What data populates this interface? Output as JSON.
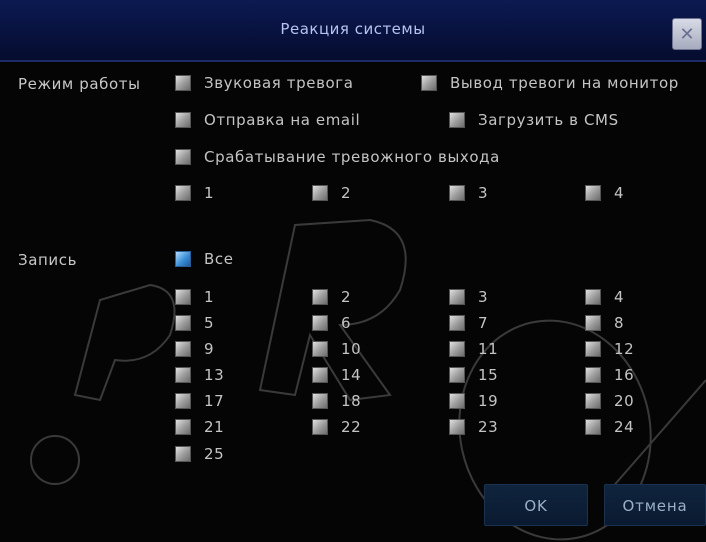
{
  "window": {
    "title": "Реакция системы",
    "close_icon": "close-icon"
  },
  "work_mode": {
    "label": "Режим работы",
    "options": [
      {
        "label": "Звуковая тревога",
        "checked": false
      },
      {
        "label": "Вывод тревоги на монитор",
        "checked": false
      },
      {
        "label": "Отправка на email",
        "checked": false
      },
      {
        "label": "Загрузить в CMS",
        "checked": false
      },
      {
        "label": "Срабатывание тревожного выхода",
        "checked": false
      }
    ],
    "outputs": [
      {
        "label": "1",
        "checked": false
      },
      {
        "label": "2",
        "checked": false
      },
      {
        "label": "3",
        "checked": false
      },
      {
        "label": "4",
        "checked": false
      }
    ]
  },
  "record": {
    "label": "Запись",
    "all": {
      "label": "Все",
      "checked": true
    },
    "channels": [
      {
        "label": "1"
      },
      {
        "label": "2"
      },
      {
        "label": "3"
      },
      {
        "label": "4"
      },
      {
        "label": "5"
      },
      {
        "label": "6"
      },
      {
        "label": "7"
      },
      {
        "label": "8"
      },
      {
        "label": "9"
      },
      {
        "label": "10"
      },
      {
        "label": "11"
      },
      {
        "label": "12"
      },
      {
        "label": "13"
      },
      {
        "label": "14"
      },
      {
        "label": "15"
      },
      {
        "label": "16"
      },
      {
        "label": "17"
      },
      {
        "label": "18"
      },
      {
        "label": "19"
      },
      {
        "label": "20"
      },
      {
        "label": "21"
      },
      {
        "label": "22"
      },
      {
        "label": "23"
      },
      {
        "label": "24"
      },
      {
        "label": "25"
      }
    ]
  },
  "buttons": {
    "ok": "OK",
    "cancel": "Отмена"
  },
  "colors": {
    "title_bar": "#0c1a52",
    "checkbox_unchecked": "#b0b0b0",
    "checkbox_checked": "#3a8fd6",
    "text": "#c4c4c4"
  }
}
